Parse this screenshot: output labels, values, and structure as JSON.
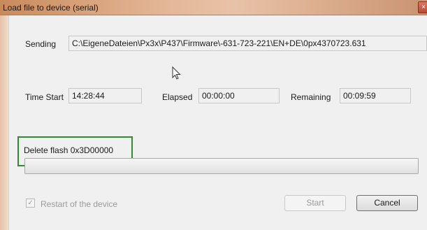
{
  "window": {
    "title": "Load file to device (serial)",
    "close_glyph": "×"
  },
  "sending": {
    "label": "Sending",
    "value": "C:\\EigeneDateien\\Px3x\\P437\\Firmware\\-631-723-221\\EN+DE\\0px4370723.631"
  },
  "time": {
    "start_label": "Time Start",
    "start_value": "14:28:44",
    "elapsed_label": "Elapsed",
    "elapsed_value": "00:00:00",
    "remaining_label": "Remaining",
    "remaining_value": "00:09:59"
  },
  "status": {
    "text": "Delete flash 0x3D00000",
    "progress_percent": 0,
    "highlight_color": "#2e8b2e"
  },
  "options": {
    "restart_label": "Restart of the device",
    "restart_checked": true,
    "restart_enabled": false
  },
  "buttons": {
    "start": "Start",
    "cancel": "Cancel"
  },
  "icons": {
    "close": "close-icon",
    "cursor": "mouse-pointer-icon",
    "checkmark": "checkmark-icon"
  }
}
